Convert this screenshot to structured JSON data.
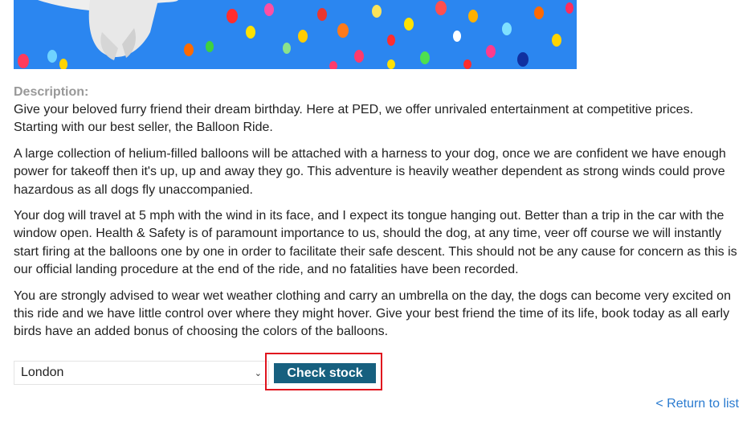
{
  "product": {
    "image_alt": "Dog lifted by colorful balloons",
    "description_label": "Description:",
    "paragraphs": [
      "Give your beloved furry friend their dream birthday. Here at PED, we offer unrivaled entertainment at competitive prices. Starting with our best seller, the Balloon Ride.",
      "A large collection of helium-filled balloons will be attached with a harness to your dog, once we are confident we have enough power for takeoff then it's up, up and away they go. This adventure is heavily weather dependent as strong winds could prove hazardous as all dogs fly unaccompanied.",
      "Your dog will travel at 5 mph with the wind in its face, and I expect its tongue hanging out. Better than a trip in the car with the window open. Health & Safety is of paramount importance to us, should the dog, at any time, veer off course we will instantly start firing at the balloons one by one in order to facilitate their safe descent. This should not be any cause for concern as this is our official landing procedure at the end of the ride, and no fatalities have been recorded.",
      "You are strongly advised to wear wet weather clothing and carry an umbrella on the day, the dogs can become very excited on this ride and we have little control over where they might hover. Give your best friend the time of its life, book today as all early birds have an added bonus of choosing the colors of the balloons."
    ]
  },
  "stock": {
    "selected_store": "London",
    "check_button_label": "Check stock",
    "highlight_color": "#e0141e",
    "button_color": "#17607f"
  },
  "nav": {
    "return_link": "< Return to list",
    "link_color": "#2a7bd0"
  }
}
